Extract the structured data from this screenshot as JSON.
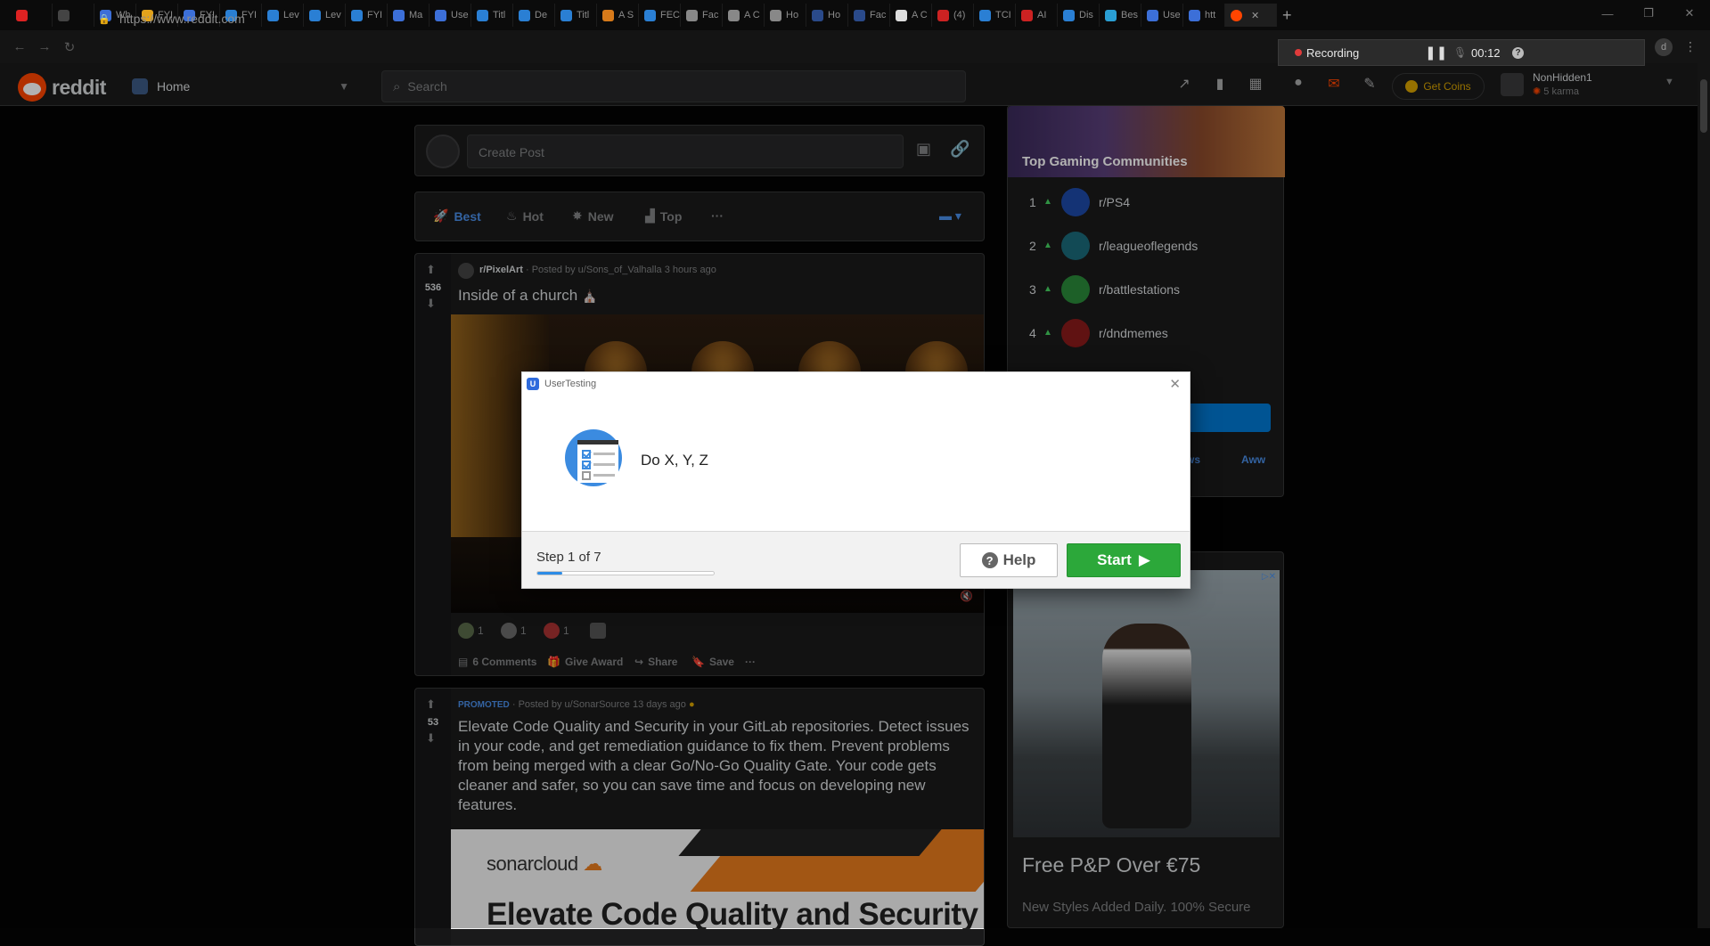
{
  "browser": {
    "tabs": [
      {
        "label": "",
        "color": "#d22"
      },
      {
        "label": "",
        "color": "#444"
      },
      {
        "label": "Wh",
        "color": "#3c6fd8"
      },
      {
        "label": "FYI",
        "color": "#e2a31c"
      },
      {
        "label": "FYI",
        "color": "#3c6fd8"
      },
      {
        "label": "FYI",
        "color": "#2a7fd4"
      },
      {
        "label": "Lev",
        "color": "#2a7fd4"
      },
      {
        "label": "Lev",
        "color": "#2a7fd4"
      },
      {
        "label": "FYI",
        "color": "#2a7fd4"
      },
      {
        "label": "Ma",
        "color": "#3c6fd8"
      },
      {
        "label": "Use",
        "color": "#3c6fd8"
      },
      {
        "label": "Titl",
        "color": "#2a7fd4"
      },
      {
        "label": "De",
        "color": "#2a7fd4"
      },
      {
        "label": "Titl",
        "color": "#2a7fd4"
      },
      {
        "label": "A S",
        "color": "#d77a1a"
      },
      {
        "label": "FEC",
        "color": "#2a7fd4"
      },
      {
        "label": "Fac",
        "color": "#888"
      },
      {
        "label": "A C",
        "color": "#888"
      },
      {
        "label": "Ho",
        "color": "#888"
      },
      {
        "label": "Ho",
        "color": "#2a4a8a"
      },
      {
        "label": "Fac",
        "color": "#2a4a8a"
      },
      {
        "label": "A C",
        "color": "#ddd"
      },
      {
        "label": "(4)",
        "color": "#c22"
      },
      {
        "label": "TCI",
        "color": "#2a7fd4"
      },
      {
        "label": "AI",
        "color": "#c22"
      },
      {
        "label": "Dis",
        "color": "#2a7fd4"
      },
      {
        "label": "Bes",
        "color": "#2a9fd4"
      },
      {
        "label": "Use",
        "color": "#3c6fd8"
      },
      {
        "label": "htt",
        "color": "#3c6fd8"
      }
    ],
    "active_tab_label": "",
    "url": "https://www.reddit.com"
  },
  "recorder": {
    "status": "Recording",
    "time": "00:12",
    "help": "?"
  },
  "reddit": {
    "brand": "reddit",
    "home_label": "Home",
    "search_placeholder": "Search",
    "get_coins": "Get Coins",
    "username": "NonHidden1",
    "karma": "5 karma",
    "create_post_placeholder": "Create Post",
    "sort": {
      "best": "Best",
      "hot": "Hot",
      "new": "New",
      "top": "Top",
      "more": "···"
    },
    "post1": {
      "subreddit": "r/PixelArt",
      "posted_by": "· Posted by u/Sons_of_Valhalla 3 hours ago",
      "votes": "536",
      "title": "Inside of a church",
      "award1_count": "1",
      "award2_count": "1",
      "award3_count": "1",
      "comments": "6 Comments",
      "give_award": "Give Award",
      "share": "Share",
      "save": "Save",
      "more": "···"
    },
    "post2": {
      "promoted": "PROMOTED",
      "posted_by": "· Posted by u/SonarSource 13 days ago",
      "votes": "53",
      "title": "Elevate Code Quality and Security in your GitLab repositories. Detect issues in your code, and get remediation guidance to fix them. Prevent problems from being merged with a clear Go/No-Go Quality Gate. Your code gets cleaner and safer, so you can save time and focus on developing new features.",
      "ad_brand": "sonarcloud",
      "ad_headline": "Elevate Code Quality and Security"
    },
    "sidebar": {
      "title": "Top Gaming Communities",
      "communities": [
        {
          "rank": "1",
          "name": "r/PS4",
          "color": "#1e4aa8"
        },
        {
          "rank": "2",
          "name": "r/leagueoflegends",
          "color": "#1b6b7a"
        },
        {
          "rank": "3",
          "name": "r/battlestations",
          "color": "#2a8a3a"
        },
        {
          "rank": "4",
          "name": "r/dndmemes",
          "color": "#8a1a1a"
        }
      ],
      "chip_partial": "ws",
      "chip_aww": "Aww"
    },
    "ad": {
      "title": "Free P&P Over €75",
      "subtitle": "New Styles Added Daily. 100% Secure"
    }
  },
  "modal": {
    "app_name": "UserTesting",
    "task": "Do X, Y, Z",
    "step_label": "Step 1 of 7",
    "progress": 0.14,
    "help": "Help",
    "start": "Start"
  }
}
